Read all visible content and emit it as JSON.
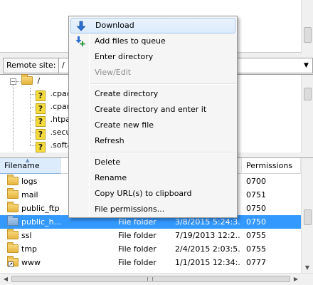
{
  "remote_site": {
    "label": "Remote site:",
    "path": "/"
  },
  "tree": {
    "root_label": "/",
    "children": [
      ".cpad",
      ".cpan",
      ".htpas",
      ".secur",
      ".softa"
    ]
  },
  "file_list": {
    "columns": {
      "filename": "Filename",
      "permissions": "Permissions"
    },
    "rows": [
      {
        "name": "logs",
        "type": "",
        "modified": "",
        "permissions": "0700",
        "selected": false,
        "link": false
      },
      {
        "name": "mail",
        "type": "",
        "modified": "",
        "permissions": "0751",
        "selected": false,
        "link": false
      },
      {
        "name": "public_ftp",
        "type": "",
        "modified": "",
        "permissions": "0750",
        "selected": false,
        "link": false
      },
      {
        "name": "public_h...",
        "type": "File folder",
        "modified": "3/8/2015 5:24:3...",
        "permissions": "0750",
        "selected": true,
        "link": false
      },
      {
        "name": "ssl",
        "type": "File folder",
        "modified": "7/19/2013 12:2...",
        "permissions": "0755",
        "selected": false,
        "link": false
      },
      {
        "name": "tmp",
        "type": "File folder",
        "modified": "2/4/2015 2:03:5...",
        "permissions": "0755",
        "selected": false,
        "link": false
      },
      {
        "name": "www",
        "type": "File folder",
        "modified": "1/1/2015 12:34:...",
        "permissions": "0777",
        "selected": false,
        "link": true
      }
    ]
  },
  "context_menu": {
    "items": [
      {
        "label": "Download",
        "icon": "download-arrow-icon",
        "highlight": true,
        "disabled": false
      },
      {
        "label": "Add files to queue",
        "icon": "add-to-queue-icon",
        "highlight": false,
        "disabled": false
      },
      {
        "label": "Enter directory",
        "icon": "",
        "highlight": false,
        "disabled": false
      },
      {
        "label": "View/Edit",
        "icon": "",
        "highlight": false,
        "disabled": true
      },
      {
        "label": "Create directory",
        "icon": "",
        "highlight": false,
        "disabled": false
      },
      {
        "label": "Create directory and enter it",
        "icon": "",
        "highlight": false,
        "disabled": false
      },
      {
        "label": "Create new file",
        "icon": "",
        "highlight": false,
        "disabled": false
      },
      {
        "label": "Refresh",
        "icon": "",
        "highlight": false,
        "disabled": false
      },
      {
        "label": "Delete",
        "icon": "",
        "highlight": false,
        "disabled": false
      },
      {
        "label": "Rename",
        "icon": "",
        "highlight": false,
        "disabled": false
      },
      {
        "label": "Copy URL(s) to clipboard",
        "icon": "",
        "highlight": false,
        "disabled": false
      },
      {
        "label": "File permissions...",
        "icon": "",
        "highlight": false,
        "disabled": false
      }
    ]
  },
  "colors": {
    "selection": "#3399ff",
    "menu_highlight": "#dbeafc",
    "disabled_text": "#8d8d8d"
  }
}
